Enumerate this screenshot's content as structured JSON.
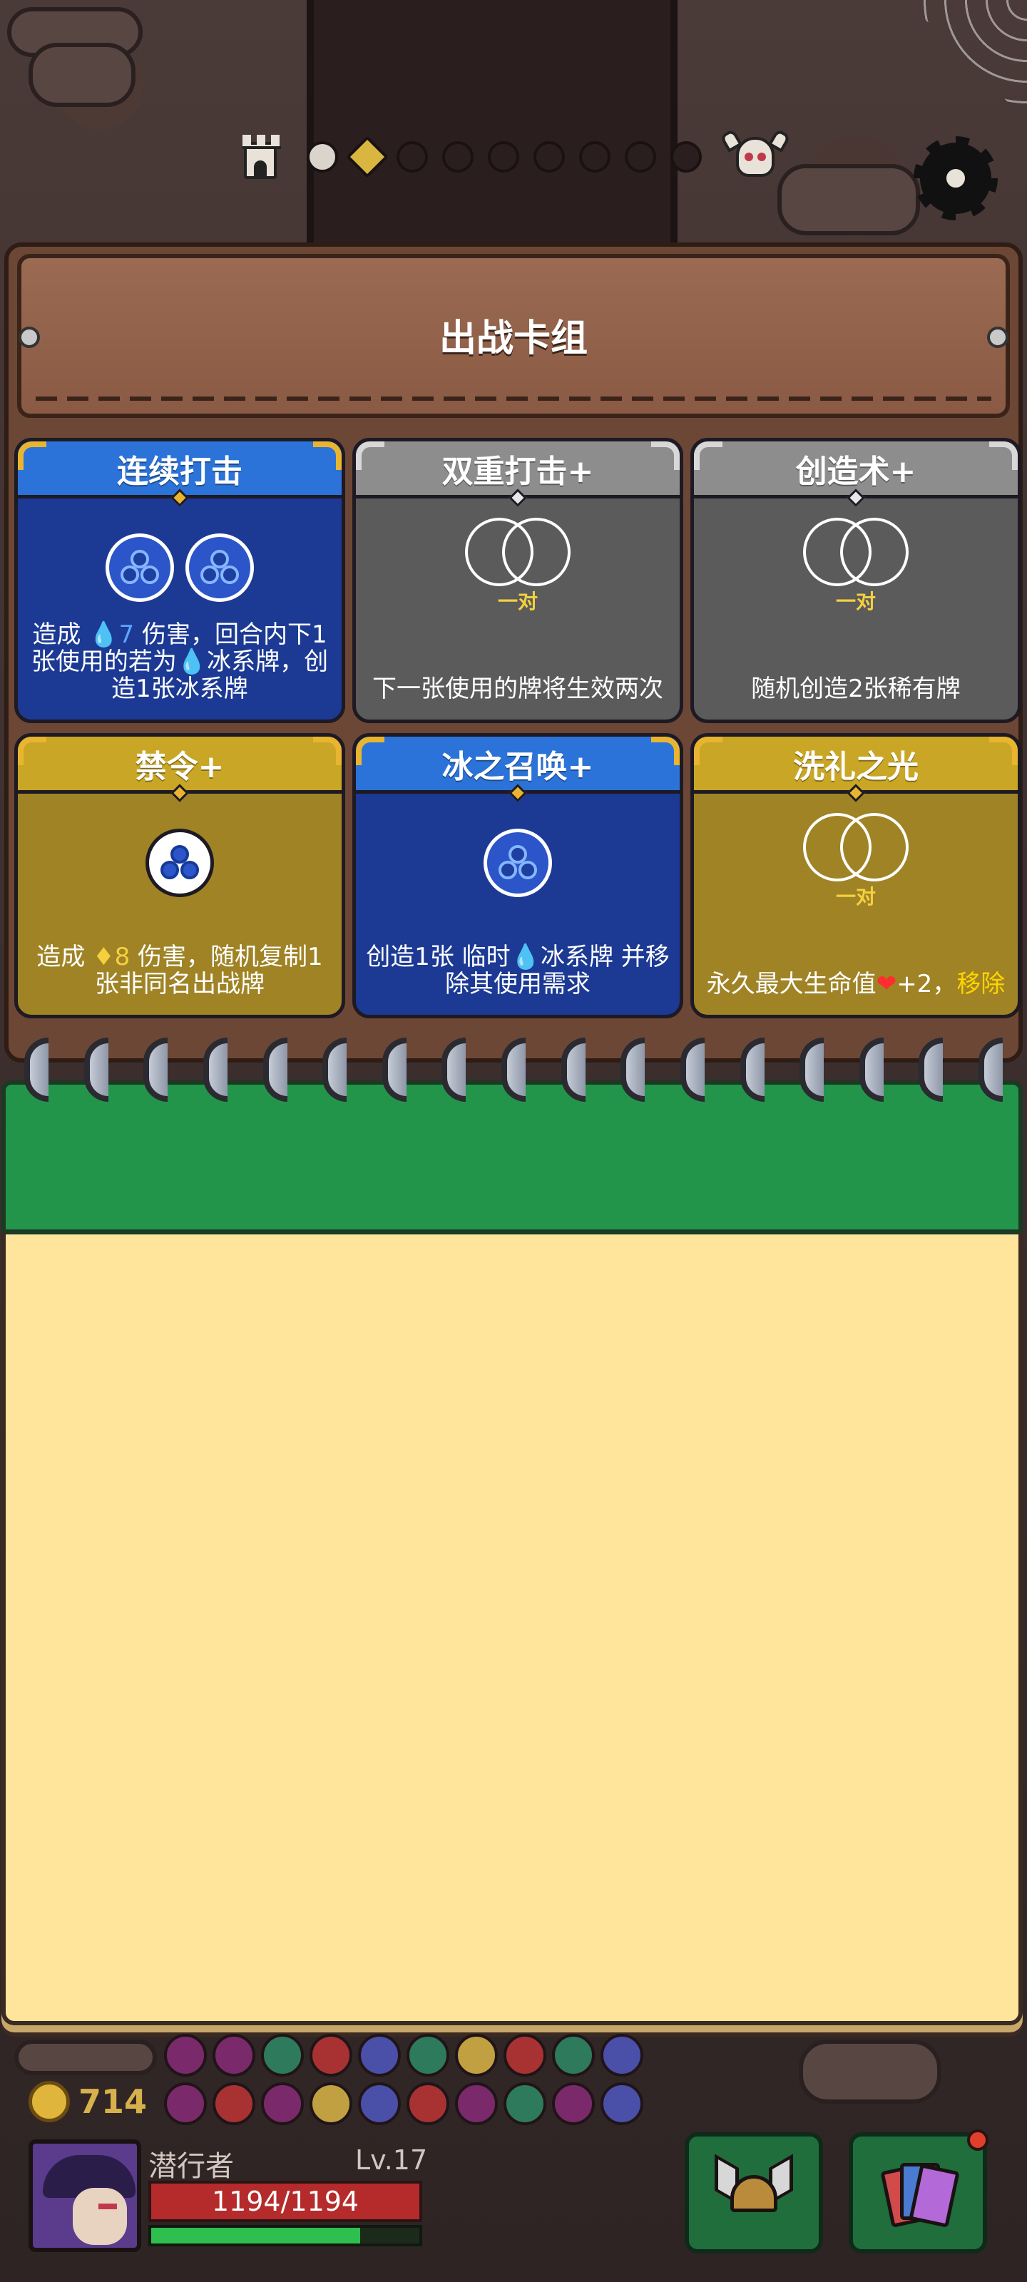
{
  "deck": {
    "title": "出战卡组",
    "cards": [
      {
        "name": "连续打击",
        "rarity": "blue",
        "requirement": "ice-orb x2",
        "desc_parts": [
          {
            "text": "造成 ",
            "style": ""
          },
          {
            "text": "💧7",
            "style": "ice"
          },
          {
            "text": " 伤害，回合内下1张使用的若为",
            "style": ""
          },
          {
            "text": "💧",
            "style": "ice"
          },
          {
            "text": "冰系牌，创造1张冰系牌",
            "style": ""
          }
        ]
      },
      {
        "name": "双重打击+",
        "rarity": "gray",
        "requirement": "pair",
        "requirement_label": "一对",
        "desc_parts": [
          {
            "text": "下一张使用的牌将生效两次",
            "style": ""
          }
        ]
      },
      {
        "name": "创造术+",
        "rarity": "gray",
        "requirement": "pair",
        "requirement_label": "一对",
        "desc_parts": [
          {
            "text": "随机创造2张稀有牌",
            "style": ""
          }
        ]
      },
      {
        "name": "禁令+",
        "rarity": "gold",
        "requirement": "ice-orb x1",
        "desc_parts": [
          {
            "text": "造成 ",
            "style": ""
          },
          {
            "text": "♦8",
            "style": "gem"
          },
          {
            "text": " 伤害，随机复制1张非同名出战牌",
            "style": ""
          }
        ]
      },
      {
        "name": "冰之召唤+",
        "rarity": "blue",
        "requirement": "ice-orb x1",
        "desc_parts": [
          {
            "text": "创造1张 临时",
            "style": ""
          },
          {
            "text": "💧",
            "style": "ice"
          },
          {
            "text": "冰系牌 并移除其使用需求",
            "style": ""
          }
        ]
      },
      {
        "name": "洗礼之光",
        "rarity": "gold",
        "requirement": "pair",
        "requirement_label": "一对",
        "desc_parts": [
          {
            "text": "永久最大生命值",
            "style": ""
          },
          {
            "text": "❤",
            "style": "heart"
          },
          {
            "text": "+2，",
            "style": ""
          },
          {
            "text": "移除",
            "style": "remove"
          }
        ]
      }
    ]
  },
  "progress": {
    "nodes_total": 9,
    "nodes_done": 1,
    "current_index": 1,
    "start_icon": "castle-icon",
    "end_icon": "boss-skull-icon"
  },
  "player": {
    "gold": "714",
    "name": "潜行者",
    "level": "Lv.17",
    "hp_text": "1194/1194",
    "xp_fraction": 0.78
  },
  "hud": {
    "left_button_icon": "helmet-icon",
    "right_button_icon": "cards-icon",
    "settings_icon": "gear-icon"
  },
  "colors": {
    "blue_card": "#1c3a94",
    "gray_card": "#5b5b5b",
    "gold_card": "#9f8325",
    "notebook_green": "#23954b",
    "notebook_page": "#ffe49c",
    "hp_red": "#b52a2a"
  }
}
